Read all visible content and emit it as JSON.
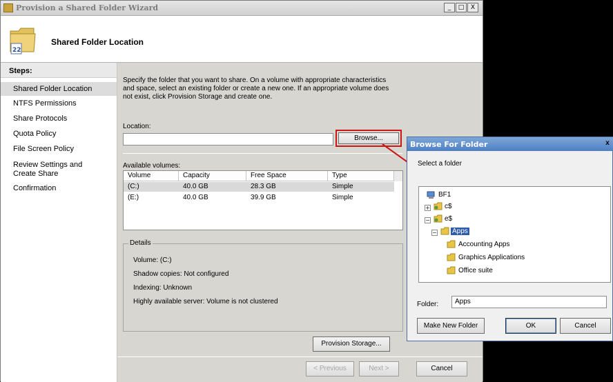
{
  "wizard": {
    "title": "Provision a Shared Folder Wizard",
    "caption_buttons": [
      "_",
      "□",
      "X"
    ],
    "header_title": "Shared Folder Location"
  },
  "steps": {
    "title": "Steps:",
    "items": [
      {
        "label": "Shared Folder Location",
        "active": true
      },
      {
        "label": "NTFS Permissions"
      },
      {
        "label": "Share Protocols"
      },
      {
        "label": "Quota Policy"
      },
      {
        "label": "File Screen Policy"
      },
      {
        "label": "Review Settings and Create Share"
      },
      {
        "label": "Confirmation"
      }
    ]
  },
  "content": {
    "intro": "Specify the folder that you want to share. On a volume with appropriate characteristics and space, select an existing folder or create a new one. If an appropriate volume does not exist, click Provision Storage and create one.",
    "location_label": "Location:",
    "location_value": "",
    "browse_label": "Browse...",
    "volumes_label": "Available volumes:",
    "volumes_columns": [
      "Volume",
      "Capacity",
      "Free Space",
      "Type"
    ],
    "volumes_rows": [
      [
        "(C:)",
        "40.0 GB",
        "28.3 GB",
        "Simple"
      ],
      [
        "(E:)",
        "40.0 GB",
        "39.9 GB",
        "Simple"
      ]
    ],
    "details": {
      "legend": "Details",
      "volume": "Volume:   (C:)",
      "shadow": "Shadow copies:   Not configured",
      "indexing": "Indexing:   Unknown",
      "ha": "Highly available server:   Volume is not clustered"
    },
    "provision_label": "Provision Storage...",
    "previous_label": "< Previous",
    "next_label": "Next >",
    "cancel_label": "Cancel"
  },
  "browse_dialog": {
    "title": "Browse For Folder",
    "close": "x",
    "prompt": "Select a folder",
    "tree": {
      "root": "BF1",
      "c_share": "c$",
      "e_share": "e$",
      "apps": "Apps",
      "children": [
        "Accounting Apps",
        "Graphics Applications",
        "Office suite"
      ]
    },
    "folder_label": "Folder:",
    "folder_value": "Apps",
    "new_folder_label": "Make New Folder",
    "ok_label": "OK",
    "cancel_label": "Cancel"
  },
  "colors": {
    "highlight_red": "#cc1616",
    "selection_blue": "#2d5cab",
    "dialog_title_blue": "#4e80c6",
    "folder_yellow": "#e8c547"
  }
}
